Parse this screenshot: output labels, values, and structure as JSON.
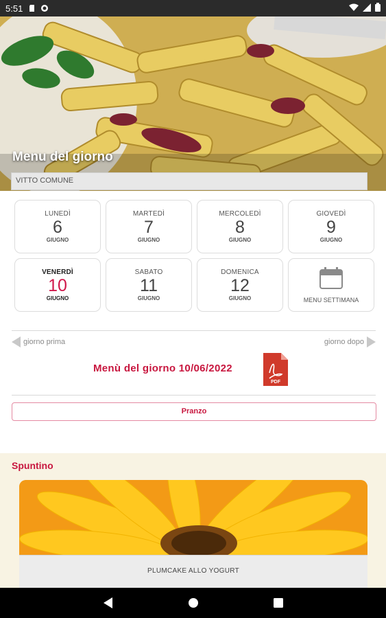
{
  "status_bar": {
    "time": "5:51",
    "left_icons": [
      "sd-card-icon",
      "sync-icon"
    ],
    "right_icons": [
      "wifi-icon",
      "signal-icon",
      "battery-icon"
    ]
  },
  "header": {
    "title": "Menu del giorno",
    "subtitle": "VITTO COMUNE"
  },
  "days": [
    {
      "name": "LUNEDÌ",
      "number": "6",
      "month": "GIUGNO",
      "active": false
    },
    {
      "name": "MARTEDÌ",
      "number": "7",
      "month": "GIUGNO",
      "active": false
    },
    {
      "name": "MERCOLEDÌ",
      "number": "8",
      "month": "GIUGNO",
      "active": false
    },
    {
      "name": "GIOVEDÌ",
      "number": "9",
      "month": "GIUGNO",
      "active": false
    },
    {
      "name": "VENERDÌ",
      "number": "10",
      "month": "GIUGNO",
      "active": true
    },
    {
      "name": "SABATO",
      "number": "11",
      "month": "GIUGNO",
      "active": false
    },
    {
      "name": "DOMENICA",
      "number": "12",
      "month": "GIUGNO",
      "active": false
    }
  ],
  "week_menu": {
    "label": "MENU SETTIMANA",
    "icon": "calendar-icon"
  },
  "navigation": {
    "prev_label": "giorno prima",
    "next_label": "giorno dopo"
  },
  "menu_date": "Menù del giorno 10/06/2022",
  "pdf": {
    "label": "PDF",
    "icon": "pdf-icon"
  },
  "meal_button": "Pranzo",
  "snack": {
    "title": "Spuntino",
    "item": "PLUMCAKE ALLO YOGURT"
  },
  "colors": {
    "accent": "#c8173f",
    "snack_background": "#f8f3e3",
    "pdf_red": "#d03a2b"
  }
}
